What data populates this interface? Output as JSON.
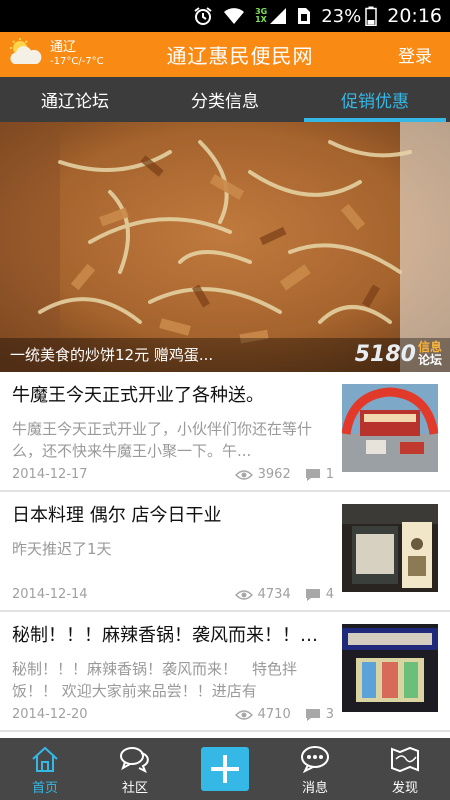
{
  "status_bar": {
    "net_top": "3G",
    "net_bottom": "1X",
    "battery": "23%",
    "time": "20:16",
    "icons": [
      "alarm-icon",
      "wifi-icon",
      "signal-icon",
      "sim-icon",
      "battery-icon"
    ]
  },
  "header": {
    "weather_city": "通辽",
    "weather_temp": "-17°C/-7°C",
    "weather_icon": "cloud-sun-icon",
    "title": "通辽惠民便民网",
    "login": "登录",
    "bg_color": "#f98a14"
  },
  "tabs": [
    {
      "label": "通辽论坛",
      "active": false
    },
    {
      "label": "分类信息",
      "active": false
    },
    {
      "label": "促销优惠",
      "active": true
    }
  ],
  "banner": {
    "caption": "一统美食的炒饼12元  赠鸡蛋...",
    "logo_main": "5180",
    "logo_sub_top": "信息",
    "logo_sub_bottom": "论坛"
  },
  "news": [
    {
      "title": "牛魔王今天正式开业了各种送。",
      "summary": "牛魔王今天正式开业了，小伙伴们你还在等什么，还不快来牛魔王小聚一下。午...",
      "date": "2014-12-17",
      "views": "3962",
      "comments": "1"
    },
    {
      "title": "日本料理 偶尔 店今日干业",
      "summary": "昨天推迟了1天",
      "date": "2014-12-14",
      "views": "4734",
      "comments": "4"
    },
    {
      "title": "秘制！！！麻辣香锅！袭风而来！！特色拌饭！！欢",
      "summary": "秘制！！！麻辣香锅！袭风而来！　特色拌饭！！ 欢迎大家前来品尝！！进店有",
      "date": "2014-12-20",
      "views": "4710",
      "comments": "3"
    }
  ],
  "bottom_nav": {
    "home": "首页",
    "community": "社区",
    "messages": "消息",
    "discover": "发现",
    "accent": "#35b8e6"
  }
}
